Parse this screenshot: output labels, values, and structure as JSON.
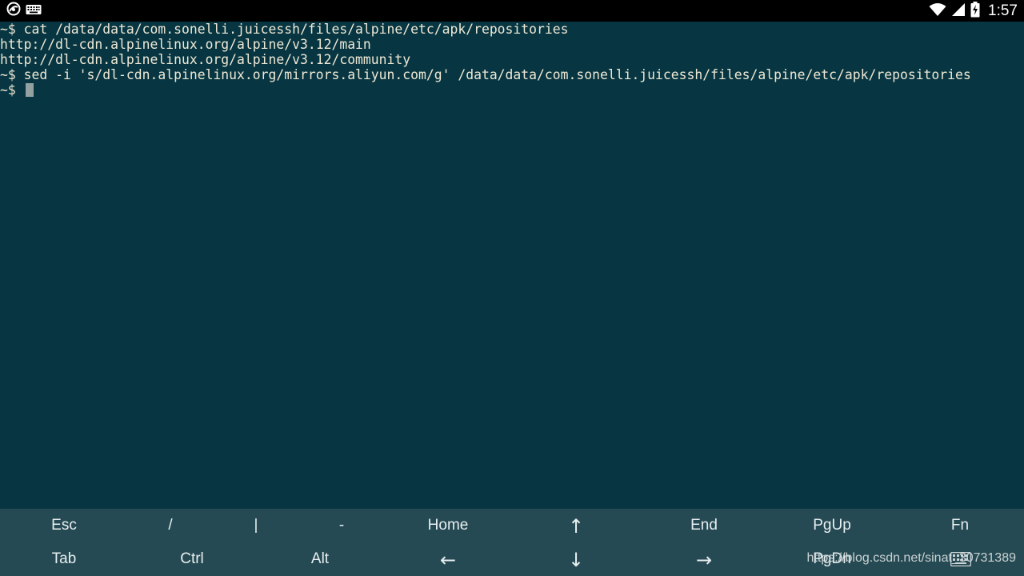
{
  "status_bar": {
    "left_icons": [
      "juicessh-icon",
      "keyboard-icon"
    ],
    "right_icons": [
      "wifi-icon",
      "signal-icon",
      "battery-icon"
    ],
    "time": "1:57"
  },
  "terminal": {
    "lines": [
      "~$ cat /data/data/com.sonelli.juicessh/files/alpine/etc/apk/repositories",
      "http://dl-cdn.alpinelinux.org/alpine/v3.12/main",
      "http://dl-cdn.alpinelinux.org/alpine/v3.12/community",
      "~$ sed -i 's/dl-cdn.alpinelinux.org/mirrors.aliyun.com/g' /data/data/com.sonelli.juicessh/files/alpine/etc/apk/repositories",
      "~$ "
    ]
  },
  "extra_keys": {
    "row1": [
      "Esc",
      "/",
      "|",
      "-",
      "Home",
      "↑",
      "End",
      "PgUp",
      "Fn"
    ],
    "row2": [
      "Tab",
      "Ctrl",
      "Alt",
      "←",
      "↓",
      "→",
      "PgDn"
    ]
  },
  "watermark": "https://blog.csdn.net/sinat_30731389",
  "colors": {
    "terminal_bg": "#073642",
    "terminal_fg": "#eee8d5",
    "keybar_bg": "#264a53",
    "statusbar_bg": "#000000"
  }
}
